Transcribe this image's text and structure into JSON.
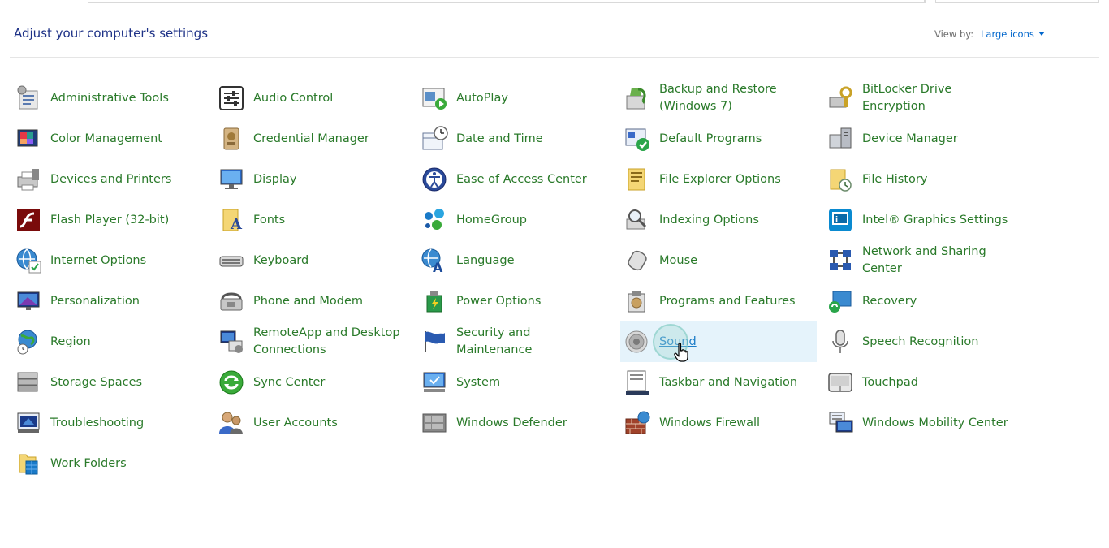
{
  "header": {
    "title": "Adjust your computer's settings",
    "view_by_label": "View by:",
    "view_by_value": "Large icons"
  },
  "items": [
    {
      "label": "Administrative Tools",
      "icon": "administrative-tools-icon"
    },
    {
      "label": "Audio Control",
      "icon": "audio-control-icon"
    },
    {
      "label": "AutoPlay",
      "icon": "autoplay-icon"
    },
    {
      "label": "Backup and Restore (Windows 7)",
      "icon": "backup-restore-icon"
    },
    {
      "label": "BitLocker Drive Encryption",
      "icon": "bitlocker-icon"
    },
    {
      "label": "Color Management",
      "icon": "color-management-icon"
    },
    {
      "label": "Credential Manager",
      "icon": "credential-manager-icon"
    },
    {
      "label": "Date and Time",
      "icon": "date-time-icon"
    },
    {
      "label": "Default Programs",
      "icon": "default-programs-icon"
    },
    {
      "label": "Device Manager",
      "icon": "device-manager-icon"
    },
    {
      "label": "Devices and Printers",
      "icon": "devices-printers-icon"
    },
    {
      "label": "Display",
      "icon": "display-icon"
    },
    {
      "label": "Ease of Access Center",
      "icon": "ease-of-access-icon"
    },
    {
      "label": "File Explorer Options",
      "icon": "file-explorer-options-icon"
    },
    {
      "label": "File History",
      "icon": "file-history-icon"
    },
    {
      "label": "Flash Player (32-bit)",
      "icon": "flash-player-icon"
    },
    {
      "label": "Fonts",
      "icon": "fonts-icon"
    },
    {
      "label": "HomeGroup",
      "icon": "homegroup-icon"
    },
    {
      "label": "Indexing Options",
      "icon": "indexing-options-icon"
    },
    {
      "label": "Intel® Graphics Settings",
      "icon": "intel-graphics-icon"
    },
    {
      "label": "Internet Options",
      "icon": "internet-options-icon"
    },
    {
      "label": "Keyboard",
      "icon": "keyboard-icon"
    },
    {
      "label": "Language",
      "icon": "language-icon"
    },
    {
      "label": "Mouse",
      "icon": "mouse-icon"
    },
    {
      "label": "Network and Sharing Center",
      "icon": "network-sharing-icon"
    },
    {
      "label": "Personalization",
      "icon": "personalization-icon"
    },
    {
      "label": "Phone and Modem",
      "icon": "phone-modem-icon"
    },
    {
      "label": "Power Options",
      "icon": "power-options-icon"
    },
    {
      "label": "Programs and Features",
      "icon": "programs-features-icon"
    },
    {
      "label": "Recovery",
      "icon": "recovery-icon"
    },
    {
      "label": "Region",
      "icon": "region-icon"
    },
    {
      "label": "RemoteApp and Desktop Connections",
      "icon": "remoteapp-icon"
    },
    {
      "label": "Security and Maintenance",
      "icon": "security-maintenance-icon"
    },
    {
      "label": "Sound",
      "icon": "sound-icon",
      "hover": true
    },
    {
      "label": "Speech Recognition",
      "icon": "speech-recognition-icon"
    },
    {
      "label": "Storage Spaces",
      "icon": "storage-spaces-icon"
    },
    {
      "label": "Sync Center",
      "icon": "sync-center-icon"
    },
    {
      "label": "System",
      "icon": "system-icon"
    },
    {
      "label": "Taskbar and Navigation",
      "icon": "taskbar-navigation-icon"
    },
    {
      "label": "Touchpad",
      "icon": "touchpad-icon"
    },
    {
      "label": "Troubleshooting",
      "icon": "troubleshooting-icon"
    },
    {
      "label": "User Accounts",
      "icon": "user-accounts-icon"
    },
    {
      "label": "Windows Defender",
      "icon": "windows-defender-icon"
    },
    {
      "label": "Windows Firewall",
      "icon": "windows-firewall-icon"
    },
    {
      "label": "Windows Mobility Center",
      "icon": "windows-mobility-icon"
    },
    {
      "label": "Work Folders",
      "icon": "work-folders-icon"
    }
  ]
}
